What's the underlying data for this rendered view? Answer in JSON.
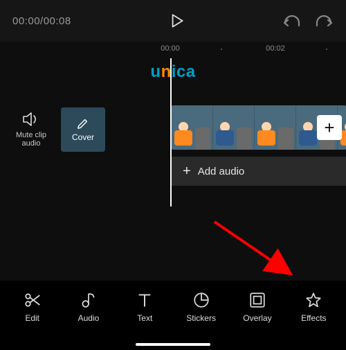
{
  "topbar": {
    "time_display": "00:00/00:08"
  },
  "ruler": {
    "marks": [
      "00:00",
      "00:02"
    ]
  },
  "watermark": {
    "text": "unica"
  },
  "timeline": {
    "mute_label_line1": "Mute clip",
    "mute_label_line2": "audio",
    "cover_label": "Cover",
    "add_audio_label": "Add audio"
  },
  "bottom_tools": [
    {
      "id": "edit",
      "label": "Edit"
    },
    {
      "id": "audio",
      "label": "Audio"
    },
    {
      "id": "text",
      "label": "Text"
    },
    {
      "id": "stickers",
      "label": "Stickers"
    },
    {
      "id": "overlay",
      "label": "Overlay"
    },
    {
      "id": "effects",
      "label": "Effects"
    }
  ]
}
